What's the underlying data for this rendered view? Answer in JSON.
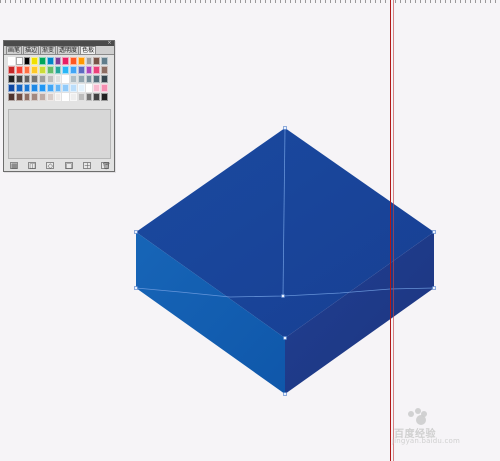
{
  "palette": {
    "tabs": [
      {
        "label": "画笔"
      },
      {
        "label": "描边"
      },
      {
        "label": "渐变"
      },
      {
        "label": "透明度"
      },
      {
        "label": "色板",
        "active": true
      }
    ]
  },
  "watermark": {
    "text": "百度经验",
    "url": "jingyan.baidu.com"
  },
  "colors": {
    "canvas": "#f6f4f7",
    "box_top": "#1a479c",
    "box_left": "#1561b2",
    "box_right": "#1f3c8f",
    "guide": "#b01818"
  }
}
